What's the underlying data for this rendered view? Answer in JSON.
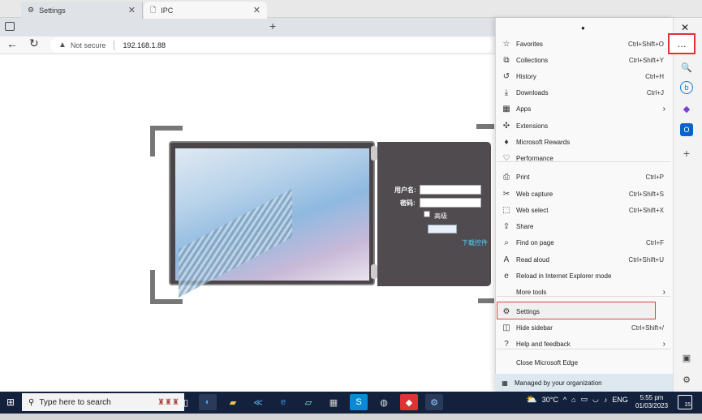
{
  "tabs": [
    {
      "label": "Settings"
    },
    {
      "label": "IPC"
    }
  ],
  "address": {
    "security": "Not secure",
    "url": "192.168.1.88"
  },
  "login": {
    "user_label": "用户名:",
    "pass_label": "密码:",
    "advanced_label": "高级",
    "download_link": "下载控件"
  },
  "menu": {
    "items": [
      {
        "label": "Favorites",
        "shortcut": "Ctrl+Shift+O",
        "icon": "star-icon"
      },
      {
        "label": "Collections",
        "shortcut": "Ctrl+Shift+Y",
        "icon": "collections-icon"
      },
      {
        "label": "History",
        "shortcut": "Ctrl+H",
        "icon": "history-icon"
      },
      {
        "label": "Downloads",
        "shortcut": "Ctrl+J",
        "icon": "download-icon"
      },
      {
        "label": "Apps",
        "shortcut": "",
        "icon": "apps-icon",
        "submenu": true
      },
      {
        "label": "Extensions",
        "shortcut": "",
        "icon": "puzzle-icon"
      },
      {
        "label": "Microsoft Rewards",
        "shortcut": "",
        "icon": "rewards-icon"
      },
      {
        "label": "Performance",
        "shortcut": "",
        "icon": "heartbeat-icon"
      },
      {
        "label": "Print",
        "shortcut": "Ctrl+P",
        "icon": "printer-icon"
      },
      {
        "label": "Web capture",
        "shortcut": "Ctrl+Shift+S",
        "icon": "capture-icon"
      },
      {
        "label": "Web select",
        "shortcut": "Ctrl+Shift+X",
        "icon": "select-icon"
      },
      {
        "label": "Share",
        "shortcut": "",
        "icon": "share-icon"
      },
      {
        "label": "Find on page",
        "shortcut": "Ctrl+F",
        "icon": "find-icon"
      },
      {
        "label": "Read aloud",
        "shortcut": "Ctrl+Shift+U",
        "icon": "read-aloud-icon"
      },
      {
        "label": "Reload in Internet Explorer mode",
        "shortcut": "",
        "icon": "ie-mode-icon"
      },
      {
        "label": "More tools",
        "shortcut": "",
        "icon": "",
        "submenu": true
      },
      {
        "label": "Settings",
        "shortcut": "",
        "icon": "gear-icon"
      },
      {
        "label": "Hide sidebar",
        "shortcut": "Ctrl+Shift+/",
        "icon": "sidebar-icon"
      },
      {
        "label": "Help and feedback",
        "shortcut": "",
        "icon": "help-icon",
        "submenu": true
      },
      {
        "label": "Close Microsoft Edge",
        "shortcut": "",
        "icon": ""
      }
    ],
    "managed": "Managed by your organization"
  },
  "taskbar": {
    "search_placeholder": "Type here to search",
    "weather": "30°C",
    "language": "ENG",
    "time": "5:55 pm",
    "date": "01/03/2023",
    "notifications": "15"
  }
}
